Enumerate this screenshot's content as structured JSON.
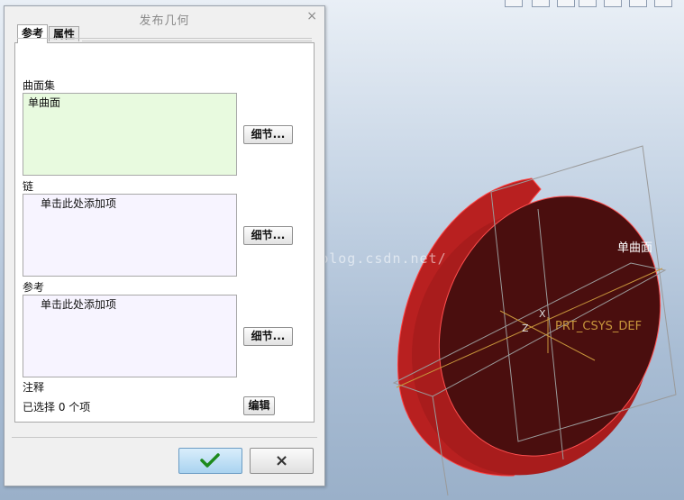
{
  "dialog": {
    "title": "发布几何",
    "close_label": "×",
    "tabs": [
      {
        "label": "参考"
      },
      {
        "label": "属性"
      }
    ],
    "sections": {
      "surface_set": {
        "label": "曲面集",
        "value": "单曲面",
        "detail_label": "细节..."
      },
      "chain": {
        "label": "链",
        "placeholder": "单击此处添加项",
        "detail_label": "细节..."
      },
      "reference": {
        "label": "参考",
        "placeholder": "单击此处添加项",
        "detail_label": "细节..."
      }
    },
    "note": {
      "label": "注释",
      "selected_text": "已选择 0 个项",
      "edit_label": "编辑"
    },
    "ok_icon": "checkmark-icon",
    "cancel_label": "×"
  },
  "viewport": {
    "surface_label": "单曲面",
    "csys_label": "PRT_CSYS_DEF",
    "axis_x": "X",
    "axis_z": "Z",
    "watermark": "http://blog.csdn.net/"
  },
  "colors": {
    "surface_set_bg": "#e8fadf",
    "list_bg": "#f7f4ff",
    "cylinder": "#b82020",
    "cylinder_face": "#4a0e0e",
    "datum": "#c8963c"
  }
}
